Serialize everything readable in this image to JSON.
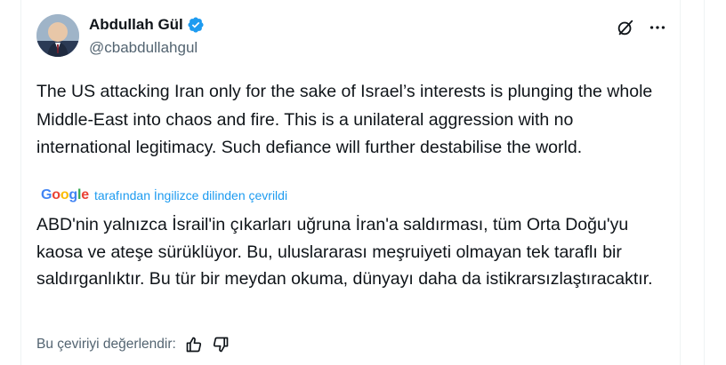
{
  "author": {
    "display_name": "Abdullah Gül",
    "handle": "@cbabdullahgul",
    "verified_icon": "verified-badge-icon",
    "avatar_icon": "avatar-photo"
  },
  "header_actions": {
    "grok_icon": "grok-icon",
    "more_icon": "more-options-icon"
  },
  "tweet": {
    "text": "The US attacking Iran only for the sake of Israel’s interests is plunging the whole Middle-East into chaos and fire. This is a unilateral aggression with no international legitimacy. Such defiance will further destabilise the world."
  },
  "translation": {
    "provider": "Google",
    "label": "tarafından İngilizce dilinden çevrildi",
    "text": "ABD'nin yalnızca İsrail'in çıkarları uğruna İran'a saldırması, tüm Orta Doğu'yu kaosa ve ateşe sürüklüyor. Bu, uluslararası meşruiyeti olmayan tek taraflı bir saldırganlıktır. Bu tür bir meydan okuma, dünyayı daha da istikrarsızlaştıracaktır.",
    "rate_label": "Bu çeviriyi değerlendir:",
    "like_icon": "thumbs-up-icon",
    "dislike_icon": "thumbs-down-icon"
  },
  "colors": {
    "text": "#0f1419",
    "secondary": "#536471",
    "accent": "#1d9bf0"
  }
}
